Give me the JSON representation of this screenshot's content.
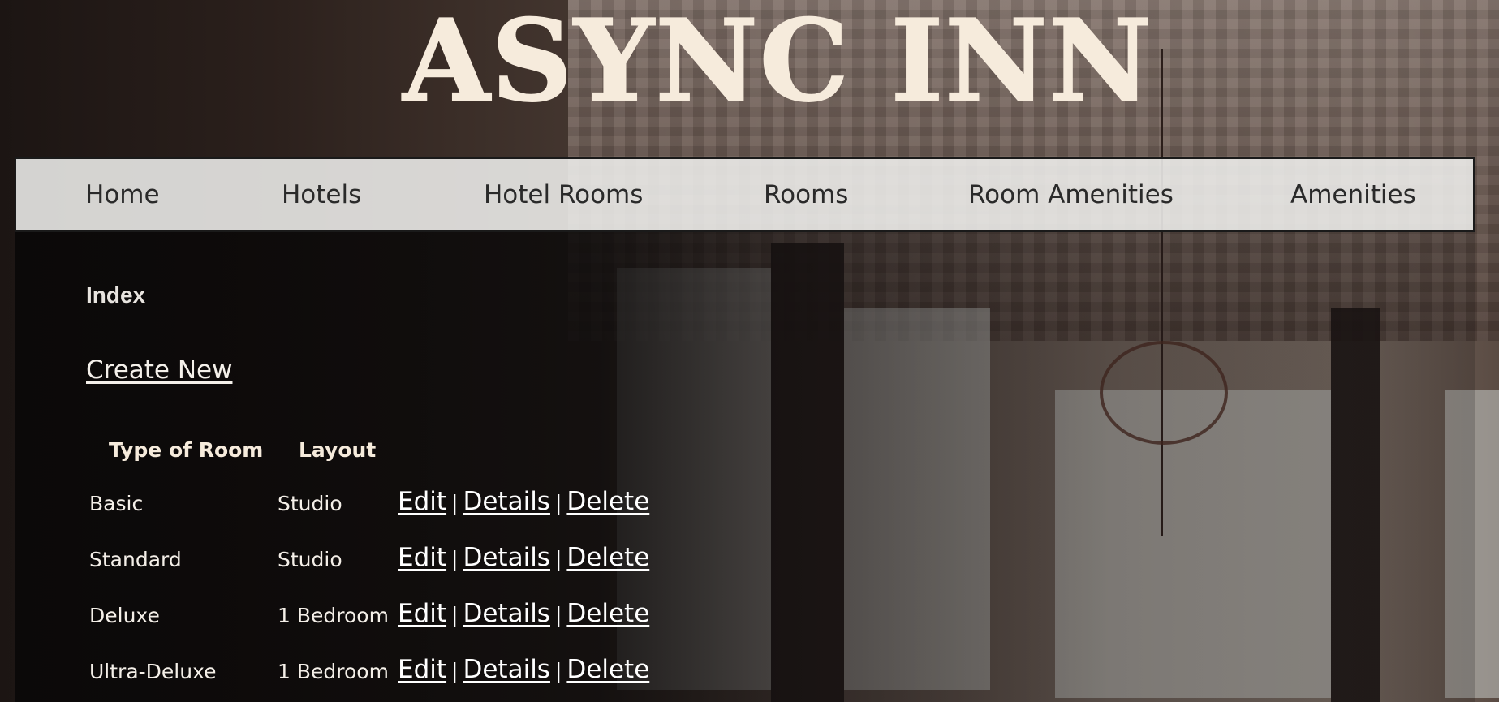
{
  "site": {
    "title": "ASYNC INN"
  },
  "nav": {
    "items": [
      "Home",
      "Hotels",
      "Hotel Rooms",
      "Rooms",
      "Room Amenities",
      "Amenities"
    ]
  },
  "page": {
    "heading": "Index",
    "create_new": "Create New"
  },
  "table": {
    "headers": [
      "Type of Room",
      "Layout"
    ],
    "rows": [
      {
        "type": "Basic",
        "layout": "Studio"
      },
      {
        "type": "Standard",
        "layout": "Studio"
      },
      {
        "type": "Deluxe",
        "layout": "1 Bedroom"
      },
      {
        "type": "Ultra-Deluxe",
        "layout": "1 Bedroom"
      }
    ],
    "actions": {
      "edit": "Edit",
      "details": "Details",
      "delete": "Delete",
      "separator": "|"
    }
  },
  "colors": {
    "title": "#f6ebdc",
    "nav_background": "#eeeeec",
    "panel": "#0a0808",
    "text": "#f4efe8"
  }
}
